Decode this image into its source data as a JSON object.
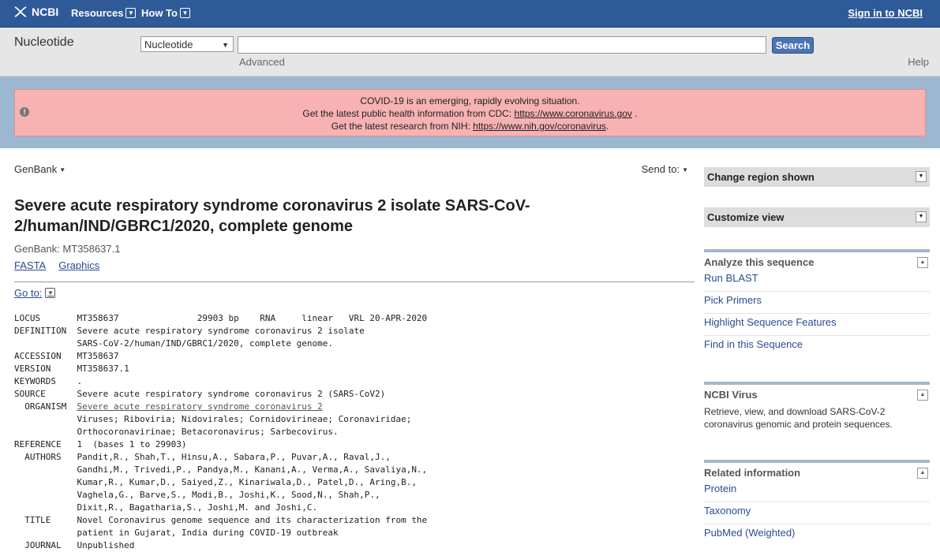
{
  "topbar": {
    "logo_text": "NCBI",
    "resources": "Resources",
    "howto": "How To",
    "signin": "Sign in to NCBI"
  },
  "search": {
    "db_label": "Nucleotide",
    "db_select": "Nucleotide",
    "term": "",
    "button": "Search",
    "advanced": "Advanced",
    "help": "Help"
  },
  "alert": {
    "line1": "COVID-19 is an emerging, rapidly evolving situation.",
    "line2_prefix": "Get the latest public health information from CDC: ",
    "line2_link": "https://www.coronavirus.gov",
    "line2_suffix": " .",
    "line3_prefix": "Get the latest research from NIH: ",
    "line3_link": "https://www.nih.gov/coronavirus",
    "line3_suffix": "."
  },
  "record": {
    "format": "GenBank",
    "send_to": "Send to:",
    "title": "Severe acute respiratory syndrome coronavirus 2 isolate SARS-CoV-2/human/IND/GBRC1/2020, complete genome",
    "accession_line": "GenBank: MT358637.1",
    "fasta": "FASTA",
    "graphics": "Graphics",
    "goto": "Go to:",
    "lines": [
      "LOCUS       MT358637               29903 bp    RNA     linear   VRL 20-APR-2020",
      "DEFINITION  Severe acute respiratory syndrome coronavirus 2 isolate",
      "            SARS-CoV-2/human/IND/GBRC1/2020, complete genome.",
      "ACCESSION   MT358637",
      "VERSION     MT358637.1",
      "KEYWORDS    .",
      "SOURCE      Severe acute respiratory syndrome coronavirus 2 (SARS-CoV2)",
      "  ORGANISM  ",
      "            Viruses; Riboviria; Nidovirales; Cornidovirineae; Coronaviridae;",
      "            Orthocoronavirinae; Betacoronavirus; Sarbecovirus.",
      "REFERENCE   1  (bases 1 to 29903)",
      "  AUTHORS   Pandit,R., Shah,T., Hinsu,A., Sabara,P., Puvar,A., Raval,J.,",
      "            Gandhi,M., Trivedi,P., Pandya,M., Kanani,A., Verma,A., Savaliya,N.,",
      "            Kumar,R., Kumar,D., Saiyed,Z., Kinariwala,D., Patel,D., Aring,B.,",
      "            Vaghela,G., Barve,S., Modi,B., Joshi,K., Sood,N., Shah,P.,",
      "            Dixit,R., Bagatharia,S., Joshi,M. and Joshi,C.",
      "  TITLE     Novel Coronavirus genome sequence and its characterization from the",
      "            patient in Gujarat, India during COVID-19 outbreak",
      "  JOURNAL   Unpublished"
    ],
    "organism_link": "Severe acute respiratory syndrome coronavirus 2"
  },
  "sidebar": {
    "change_region": "Change region shown",
    "customize_view": "Customize view",
    "analyze": {
      "heading": "Analyze this sequence",
      "items": [
        "Run BLAST",
        "Pick Primers",
        "Highlight Sequence Features",
        "Find in this Sequence"
      ]
    },
    "ncbi_virus": {
      "heading": "NCBI Virus",
      "desc": "Retrieve, view, and download SARS-CoV-2 coronavirus genomic and protein sequences."
    },
    "related": {
      "heading": "Related information",
      "items": [
        "Protein",
        "Taxonomy",
        "PubMed (Weighted)"
      ]
    }
  }
}
